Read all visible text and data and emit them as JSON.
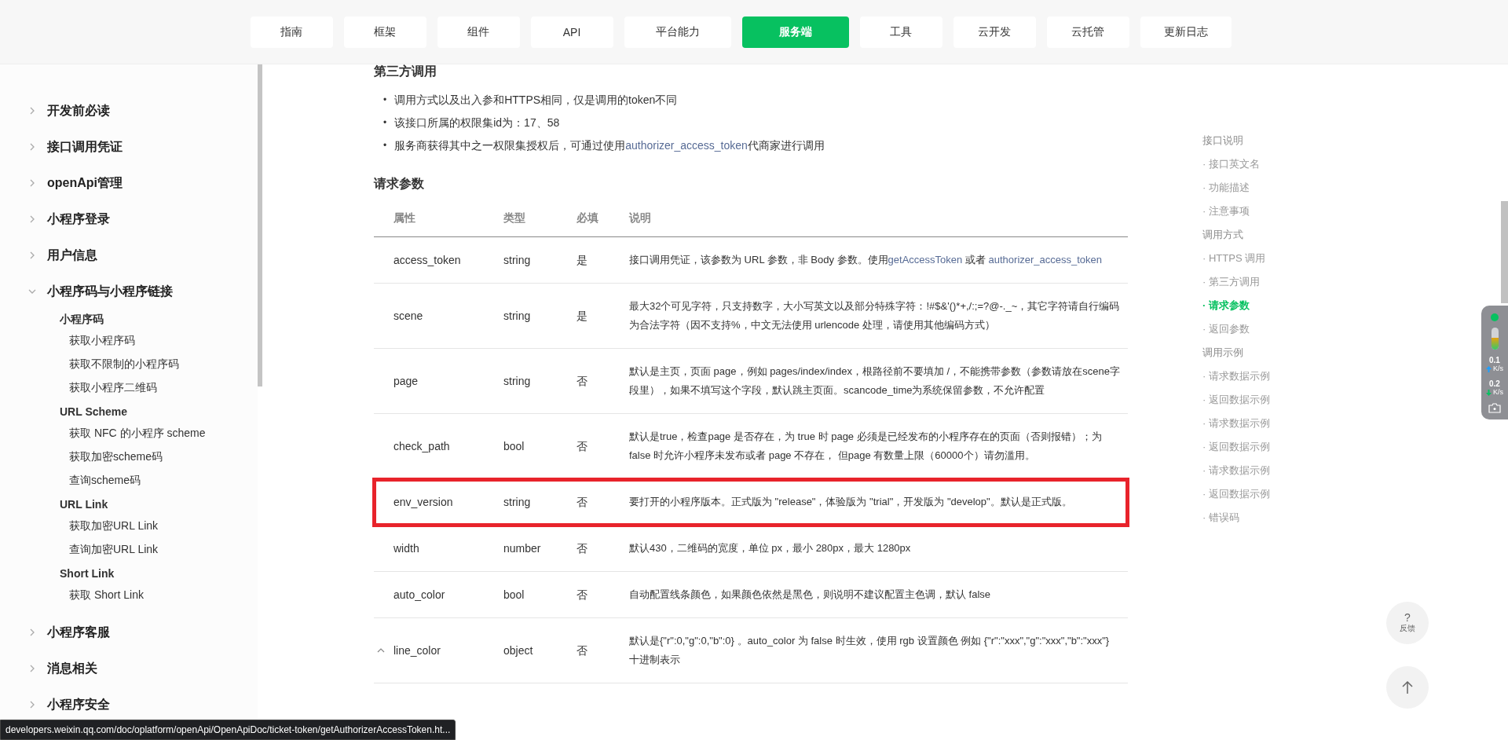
{
  "nav": [
    {
      "label": "指南",
      "selected": false
    },
    {
      "label": "框架",
      "selected": false
    },
    {
      "label": "组件",
      "selected": false
    },
    {
      "label": "API",
      "selected": false
    },
    {
      "label": "平台能力",
      "selected": false
    },
    {
      "label": "服务端",
      "selected": true
    },
    {
      "label": "工具",
      "selected": false
    },
    {
      "label": "云开发",
      "selected": false
    },
    {
      "label": "云托管",
      "selected": false
    },
    {
      "label": "更新日志",
      "selected": false
    }
  ],
  "sidebar": {
    "items": [
      {
        "label": "开发前必读",
        "expanded": false
      },
      {
        "label": "接口调用凭证",
        "expanded": false
      },
      {
        "label": "openApi管理",
        "expanded": false
      },
      {
        "label": "小程序登录",
        "expanded": false
      },
      {
        "label": "用户信息",
        "expanded": false
      },
      {
        "label": "小程序码与小程序链接",
        "expanded": true,
        "children": [
          {
            "label": "小程序码",
            "children": [
              {
                "label": "获取小程序码"
              },
              {
                "label": "获取不限制的小程序码"
              },
              {
                "label": "获取小程序二维码"
              }
            ]
          },
          {
            "label": "URL Scheme",
            "children": [
              {
                "label": "获取 NFC 的小程序 scheme"
              },
              {
                "label": "获取加密scheme码"
              },
              {
                "label": "查询scheme码"
              }
            ]
          },
          {
            "label": "URL Link",
            "children": [
              {
                "label": "获取加密URL Link"
              },
              {
                "label": "查询加密URL Link"
              }
            ]
          },
          {
            "label": "Short Link",
            "children": [
              {
                "label": "获取 Short Link"
              }
            ]
          }
        ]
      },
      {
        "label": "小程序客服",
        "expanded": false
      },
      {
        "label": "消息相关",
        "expanded": false
      },
      {
        "label": "小程序安全",
        "expanded": false
      }
    ]
  },
  "content": {
    "heading": "第三方调用",
    "bullets": [
      {
        "marker": "•",
        "parts": [
          {
            "kind": "text",
            "text": "调用方式以及出入参和HTTPS相同，仅是调用的token不同"
          }
        ]
      },
      {
        "marker": "•",
        "parts": [
          {
            "kind": "text",
            "text": "该接口所属的权限集id为：17、58"
          }
        ]
      },
      {
        "marker": "•",
        "parts": [
          {
            "kind": "text",
            "text": "服务商获得其中之一权限集授权后，可通过使用"
          },
          {
            "kind": "link",
            "text": "authorizer_access_token"
          },
          {
            "kind": "text",
            "text": "代商家进行调用"
          }
        ]
      }
    ],
    "section_title": "请求参数",
    "table": {
      "columns": [
        "属性",
        "类型",
        "必填",
        "说明"
      ],
      "rows": [
        {
          "kind": "plain",
          "highlighted": false,
          "name": "access_token",
          "type": "string",
          "required": "是",
          "description": [
            {
              "kind": "text",
              "text": "接口调用凭证，该参数为 URL 参数，非 Body 参数。使用"
            },
            {
              "kind": "link",
              "text": "getAccessToken"
            },
            {
              "kind": "text",
              "text": " 或者 "
            },
            {
              "kind": "link",
              "text": "authorizer_access_token"
            }
          ]
        },
        {
          "kind": "plain",
          "highlighted": false,
          "name": "scene",
          "type": "string",
          "required": "是",
          "description": [
            {
              "kind": "text",
              "text": "最大32个可见字符，只支持数字，大小写英文以及部分特殊字符：!#$&'()*+,/:;=?@-._~，其它字符请自行编码为合法字符（因不支持%，中文无法使用 urlencode 处理，请使用其他编码方式）"
            }
          ]
        },
        {
          "kind": "plain",
          "highlighted": false,
          "name": "page",
          "type": "string",
          "required": "否",
          "description": [
            {
              "kind": "text",
              "text": "默认是主页，页面 page，例如 pages/index/index，根路径前不要填加 /，不能携带参数（参数请放在scene字段里），如果不填写这个字段，默认跳主页面。scancode_time为系统保留参数，不允许配置"
            }
          ]
        },
        {
          "kind": "plain",
          "highlighted": false,
          "name": "check_path",
          "type": "bool",
          "required": "否",
          "description": [
            {
              "kind": "text",
              "text": "默认是true，检查page 是否存在，为 true 时 page 必须是已经发布的小程序存在的页面（否则报错）；为 false 时允许小程序未发布或者 page 不存在， 但page 有数量上限（60000个）请勿滥用。"
            }
          ]
        },
        {
          "kind": "plain",
          "highlighted": true,
          "name": "env_version",
          "type": "string",
          "required": "否",
          "description": [
            {
              "kind": "text",
              "text": "要打开的小程序版本。正式版为 \"release\"，体验版为 \"trial\"，开发版为 \"develop\"。默认是正式版。"
            }
          ]
        },
        {
          "kind": "plain",
          "highlighted": false,
          "name": "width",
          "type": "number",
          "required": "否",
          "description": [
            {
              "kind": "text",
              "text": "默认430，二维码的宽度，单位 px，最小 280px，最大 1280px"
            }
          ]
        },
        {
          "kind": "plain",
          "highlighted": false,
          "name": "auto_color",
          "type": "bool",
          "required": "否",
          "description": [
            {
              "kind": "text",
              "text": "自动配置线条颜色，如果颜色依然是黑色，则说明不建议配置主色调，默认 false"
            }
          ]
        },
        {
          "kind": "expandable",
          "highlighted": false,
          "name": "line_color",
          "type": "object",
          "required": "否",
          "description": [
            {
              "kind": "text",
              "text": "默认是{\"r\":0,\"g\":0,\"b\":0} 。auto_color 为 false 时生效，使用 rgb 设置颜色 例如 {\"r\":\"xxx\",\"g\":\"xxx\",\"b\":\"xxx\"} 十进制表示"
            }
          ]
        }
      ]
    }
  },
  "toc": [
    {
      "kind": "section",
      "label": "接口说明",
      "selected": false
    },
    {
      "kind": "sub",
      "label": "· 接口英文名",
      "selected": false
    },
    {
      "kind": "sub",
      "label": "· 功能描述",
      "selected": false
    },
    {
      "kind": "sub",
      "label": "· 注意事项",
      "selected": false
    },
    {
      "kind": "section",
      "label": "调用方式",
      "selected": false
    },
    {
      "kind": "sub",
      "label": "· HTTPS 调用",
      "selected": false
    },
    {
      "kind": "sub",
      "label": "· 第三方调用",
      "selected": false
    },
    {
      "kind": "sub",
      "label": "· 请求参数",
      "selected": true
    },
    {
      "kind": "sub",
      "label": "· 返回参数",
      "selected": false
    },
    {
      "kind": "section",
      "label": "调用示例",
      "selected": false
    },
    {
      "kind": "sub",
      "label": "· 请求数据示例",
      "selected": false
    },
    {
      "kind": "sub",
      "label": "· 返回数据示例",
      "selected": false
    },
    {
      "kind": "sub",
      "label": "· 请求数据示例",
      "selected": false
    },
    {
      "kind": "sub",
      "label": "· 返回数据示例",
      "selected": false
    },
    {
      "kind": "sub",
      "label": "· 请求数据示例",
      "selected": false
    },
    {
      "kind": "sub",
      "label": "· 返回数据示例",
      "selected": false
    },
    {
      "kind": "sub",
      "label": "· 错误码",
      "selected": false
    }
  ],
  "monitor": {
    "level": 0.55,
    "upload": "0.1",
    "download": "0.2",
    "unit_up": "K/s",
    "unit_down": "K/s"
  },
  "feedback": {
    "icon": "?",
    "label": "反馈"
  },
  "status_url": "developers.weixin.qq.com/doc/oplatform/openApi/OpenApiDoc/ticket-token/getAuthorizerAccessToken.ht..."
}
